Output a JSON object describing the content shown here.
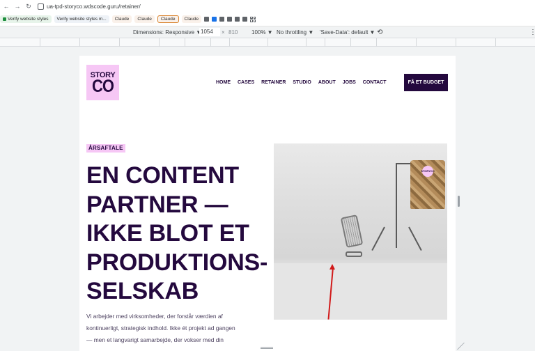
{
  "browser": {
    "url": "ua-tpd-storyco.wdscode.guru/retainer/",
    "nav_back": "←",
    "nav_forward": "→",
    "nav_reload": "↻"
  },
  "bookmarks": [
    {
      "label": "Verify website styles",
      "style": "green"
    },
    {
      "label": "Verify website styles m...",
      "style": "plain"
    },
    {
      "label": "Claude",
      "style": "claude"
    },
    {
      "label": "Claude",
      "style": "claude"
    },
    {
      "label": "Claude",
      "style": "claude-active"
    },
    {
      "label": "Claude",
      "style": "claude"
    }
  ],
  "devtools": {
    "dimensions": "Dimensions: Responsive ▼",
    "width": "1054",
    "times": "×",
    "height": "810",
    "zoom": "100% ▼",
    "throttling": "No throttling ▼",
    "save_data": "'Save-Data': default ▼",
    "rotate_icon": "⟲",
    "more_icon": "⋮"
  },
  "site": {
    "logo_line1": "STORY",
    "logo_line2": "CO",
    "nav": [
      "HOME",
      "CASES",
      "RETAINER",
      "STUDIO",
      "ABOUT",
      "JOBS",
      "CONTACT"
    ],
    "cta": "FÅ ET BUDGET",
    "badge": "ÅRSAFTALE",
    "title_lines": [
      "EN CONTENT",
      "PARTNER —",
      "IKKE BLOT ET",
      "PRODUKTIONS-",
      "SELSKAB"
    ],
    "body_lines": [
      "Vi arbejder med virksomheder, der forstår værdien af",
      "kontinuerligt, strategisk indhold. Ikke ét projekt ad gangen",
      "— men et langvarigt samarbejde, der vokser med din"
    ],
    "image_badge_line1": "STORY",
    "image_badge_line2": "CO"
  },
  "colors": {
    "brand_dark": "#24093e",
    "brand_pink": "#f6c7f5",
    "annotation_red": "#d11a1a"
  }
}
